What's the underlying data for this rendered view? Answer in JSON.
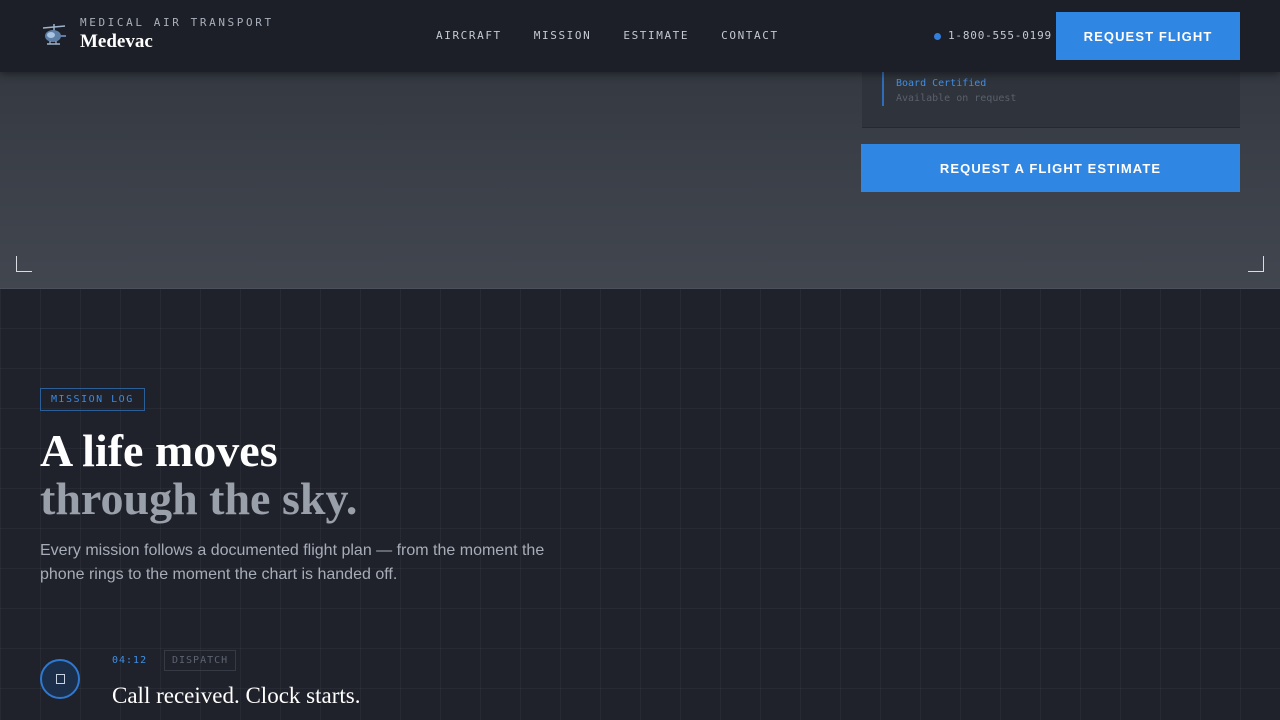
{
  "header": {
    "kicker": "MEDICAL AIR TRANSPORT",
    "brand": "Medevac",
    "nav": [
      {
        "label": "AIRCRAFT"
      },
      {
        "label": "MISSION"
      },
      {
        "label": "ESTIMATE"
      },
      {
        "label": "CONTACT"
      }
    ],
    "phone": "1-800-555-0199",
    "cta": "REQUEST FLIGHT"
  },
  "hero": {
    "cert_title": "Board Certified",
    "cert_sub": "Available on request",
    "estimate_cta": "REQUEST A FLIGHT ESTIMATE"
  },
  "mission": {
    "tag": "MISSION LOG",
    "headline_line1": "A life moves",
    "headline_line2": "through the sky.",
    "lede": "Every mission follows a documented flight plan — from the moment the phone rings to the moment the chart is handed off.",
    "steps": [
      {
        "time": "04:12",
        "phase": "DISPATCH",
        "title": "Call received. Clock starts."
      }
    ]
  },
  "colors": {
    "accent": "#2f86e3",
    "header_bg": "#1c1f27",
    "section_bg": "#1f222b"
  },
  "icons": {
    "logo": "helicopter-icon",
    "step": "phone-icon"
  }
}
